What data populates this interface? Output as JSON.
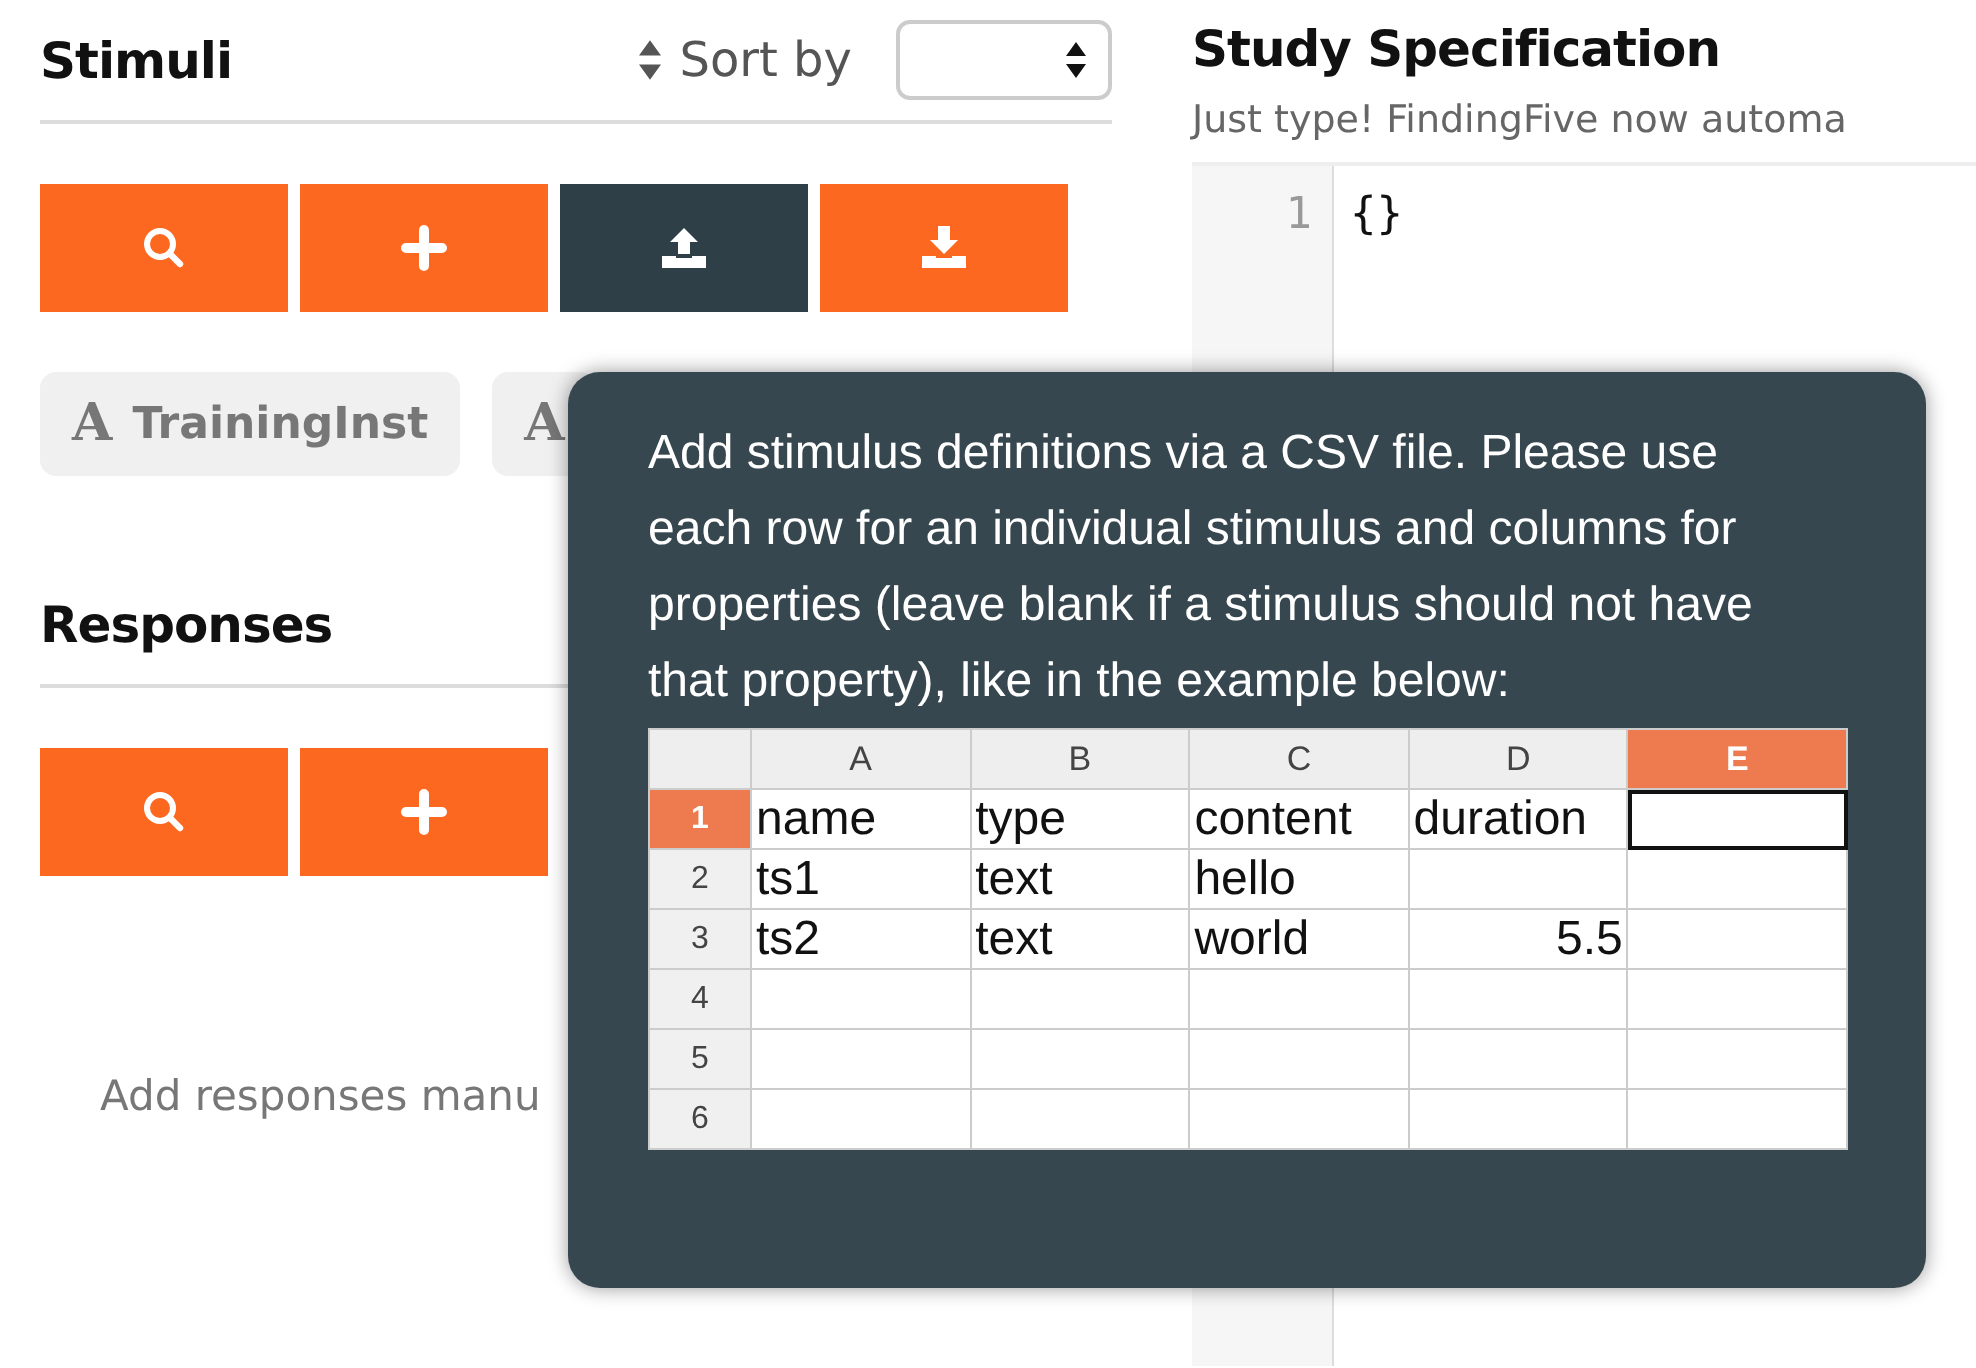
{
  "stimuli": {
    "title": "Stimuli",
    "sort_label": "Sort by",
    "toolbar": [
      {
        "kind": "search",
        "active": false
      },
      {
        "kind": "add",
        "active": false
      },
      {
        "kind": "upload",
        "active": true
      },
      {
        "kind": "download",
        "active": false
      }
    ],
    "items": [
      {
        "icon": "A",
        "label": "TrainingInst"
      },
      {
        "icon": "A"
      }
    ]
  },
  "responses": {
    "title": "Responses",
    "toolbar": [
      {
        "kind": "search",
        "active": false
      },
      {
        "kind": "add",
        "active": false
      }
    ],
    "empty_text": "Add responses manu"
  },
  "spec": {
    "title": "Study Specification",
    "subtitle": "Just type! FindingFive now automa",
    "lines": [
      {
        "number": "1",
        "code": "{}"
      }
    ]
  },
  "tooltip": {
    "text": "Add stimulus definitions via a CSV file. Please use each row for an individual stimulus and columns for properties (leave blank if a stimulus should not have that property), like in the example below:",
    "sheet": {
      "columns": [
        {
          "label": "A",
          "selected": false
        },
        {
          "label": "B",
          "selected": false
        },
        {
          "label": "C",
          "selected": false
        },
        {
          "label": "D",
          "selected": false
        },
        {
          "label": "E",
          "selected": true
        }
      ],
      "rows": [
        {
          "number": "1",
          "selected": true,
          "cells": [
            "name",
            "type",
            "content",
            "duration",
            null
          ]
        },
        {
          "number": "2",
          "selected": false,
          "cells": [
            "ts1",
            "text",
            "hello",
            null,
            null
          ]
        },
        {
          "number": "3",
          "selected": false,
          "cells": [
            "ts2",
            "text",
            "world",
            "5.5",
            null
          ]
        },
        {
          "number": "4",
          "selected": false,
          "cells": [
            null,
            null,
            null,
            null,
            null
          ]
        },
        {
          "number": "5",
          "selected": false,
          "cells": [
            null,
            null,
            null,
            null,
            null
          ]
        },
        {
          "number": "6",
          "selected": false,
          "cells": [
            null,
            null,
            null,
            null,
            null
          ]
        }
      ]
    }
  }
}
